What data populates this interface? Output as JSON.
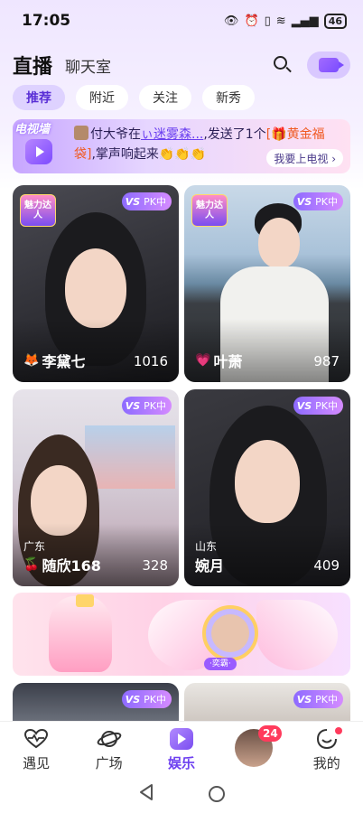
{
  "status_bar": {
    "time": "17:05",
    "icons": [
      "eye-icon",
      "alarm-icon",
      "vibrate-icon",
      "wifi-icon",
      "signal-5g-icon"
    ],
    "battery": "46"
  },
  "header": {
    "title": "直播",
    "subtitle": "聊天室"
  },
  "tabs": [
    {
      "label": "推荐",
      "active": true
    },
    {
      "label": "附近",
      "active": false
    },
    {
      "label": "关注",
      "active": false
    },
    {
      "label": "新秀",
      "active": false
    }
  ],
  "tv_banner": {
    "label": "电视墙",
    "prefix": "付大爷在",
    "user": "ぃ迷雾森...",
    "middle": "发送了1个",
    "gift": "黄金福袋",
    "suffix": ",掌声响起来",
    "claps": "👏👏👏",
    "cta": "我要上电视 ›"
  },
  "pk_badge": {
    "vs": "VS",
    "text": "PK中"
  },
  "talent_badge": "魅力达人",
  "cards": [
    {
      "name": "李黛七",
      "region": "",
      "viewers": "1016",
      "pk": true,
      "talent": true,
      "icon": "fox-icon"
    },
    {
      "name": "叶萧",
      "region": "",
      "viewers": "987",
      "pk": true,
      "talent": true,
      "icon": "heart-icon"
    },
    {
      "name": "随欣168",
      "region": "广东",
      "viewers": "328",
      "pk": true,
      "talent": false,
      "icon": "cherry-icon"
    },
    {
      "name": "婉月",
      "region": "山东",
      "viewers": "409",
      "pk": true,
      "talent": false,
      "icon": ""
    }
  ],
  "promo": {
    "plate": "·奕霸·"
  },
  "bottom_nav": [
    {
      "label": "遇见",
      "icon": "heart-pulse-icon",
      "active": false
    },
    {
      "label": "广场",
      "icon": "planet-icon",
      "active": false
    },
    {
      "label": "娱乐",
      "icon": "play-icon",
      "active": true
    },
    {
      "label": "",
      "icon": "avatar",
      "active": false,
      "badge": "24"
    },
    {
      "label": "我的",
      "icon": "smiley-icon",
      "active": false,
      "dot": true
    }
  ],
  "colors": {
    "accent": "#6d3ff0",
    "badge": "#ff3b5c",
    "tab_active_bg": "#ded2ff"
  }
}
